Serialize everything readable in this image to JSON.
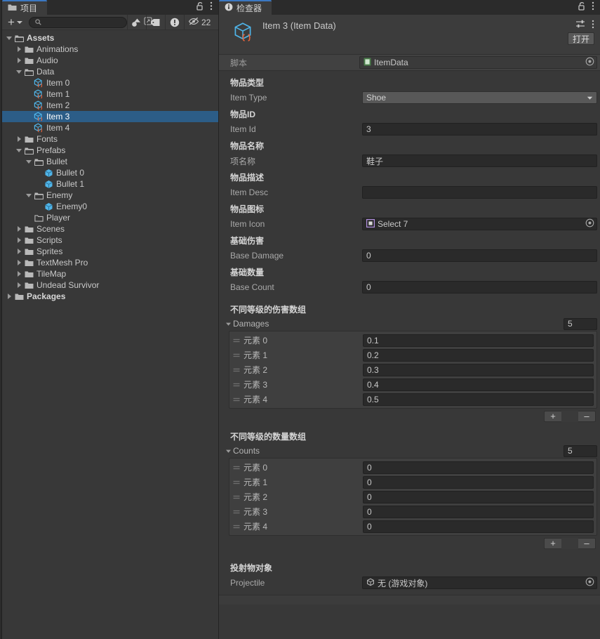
{
  "project_panel": {
    "tab_label": "项目",
    "tab_icon": "folder-icon",
    "lock_icon": "lock-open-icon",
    "menu_icon": "kebab-menu-icon",
    "toolbar": {
      "add_label": "+",
      "search_placeholder": "",
      "search_value": "",
      "search_icon": "search-icon",
      "save_search_icon": "save-search-icon",
      "filter_type_icon": "filter-by-type-icon",
      "filter_label_icon": "filter-by-label-icon",
      "filter_error_icon": "filter-by-error-icon",
      "hidden_icon": "eye-crossed-icon",
      "hidden_count": "22"
    },
    "tree": [
      {
        "label": "Assets",
        "indent": 0,
        "expand": "open",
        "icon": "folder-open-icon",
        "bold": true,
        "selected": false
      },
      {
        "label": "Animations",
        "indent": 1,
        "expand": "closed",
        "icon": "folder-icon",
        "bold": false,
        "selected": false
      },
      {
        "label": "Audio",
        "indent": 1,
        "expand": "closed",
        "icon": "folder-icon",
        "bold": false,
        "selected": false
      },
      {
        "label": "Data",
        "indent": 1,
        "expand": "open",
        "icon": "folder-open-icon",
        "bold": false,
        "selected": false
      },
      {
        "label": "Item 0",
        "indent": 2,
        "expand": "none",
        "icon": "scriptable-object-icon",
        "bold": false,
        "selected": false
      },
      {
        "label": "Item 1",
        "indent": 2,
        "expand": "none",
        "icon": "scriptable-object-icon",
        "bold": false,
        "selected": false
      },
      {
        "label": "Item 2",
        "indent": 2,
        "expand": "none",
        "icon": "scriptable-object-icon",
        "bold": false,
        "selected": false
      },
      {
        "label": "Item 3",
        "indent": 2,
        "expand": "none",
        "icon": "scriptable-object-icon",
        "bold": false,
        "selected": true
      },
      {
        "label": "Item 4",
        "indent": 2,
        "expand": "none",
        "icon": "scriptable-object-icon",
        "bold": false,
        "selected": false
      },
      {
        "label": "Fonts",
        "indent": 1,
        "expand": "closed",
        "icon": "folder-icon",
        "bold": false,
        "selected": false
      },
      {
        "label": "Prefabs",
        "indent": 1,
        "expand": "open",
        "icon": "folder-open-icon",
        "bold": false,
        "selected": false
      },
      {
        "label": "Bullet",
        "indent": 2,
        "expand": "open",
        "icon": "folder-open-icon",
        "bold": false,
        "selected": false
      },
      {
        "label": "Bullet 0",
        "indent": 3,
        "expand": "none",
        "icon": "prefab-icon",
        "bold": false,
        "selected": false
      },
      {
        "label": "Bullet 1",
        "indent": 3,
        "expand": "none",
        "icon": "prefab-icon",
        "bold": false,
        "selected": false
      },
      {
        "label": "Enemy",
        "indent": 2,
        "expand": "open",
        "icon": "folder-open-icon",
        "bold": false,
        "selected": false
      },
      {
        "label": "Enemy0",
        "indent": 3,
        "expand": "none",
        "icon": "prefab-icon",
        "bold": false,
        "selected": false
      },
      {
        "label": "Player",
        "indent": 2,
        "expand": "none",
        "icon": "folder-empty-icon",
        "bold": false,
        "selected": false
      },
      {
        "label": "Scenes",
        "indent": 1,
        "expand": "closed",
        "icon": "folder-icon",
        "bold": false,
        "selected": false
      },
      {
        "label": "Scripts",
        "indent": 1,
        "expand": "closed",
        "icon": "folder-icon",
        "bold": false,
        "selected": false
      },
      {
        "label": "Sprites",
        "indent": 1,
        "expand": "closed",
        "icon": "folder-icon",
        "bold": false,
        "selected": false
      },
      {
        "label": "TextMesh Pro",
        "indent": 1,
        "expand": "closed",
        "icon": "folder-icon",
        "bold": false,
        "selected": false
      },
      {
        "label": "TileMap",
        "indent": 1,
        "expand": "closed",
        "icon": "folder-icon",
        "bold": false,
        "selected": false
      },
      {
        "label": "Undead Survivor",
        "indent": 1,
        "expand": "closed",
        "icon": "folder-icon",
        "bold": false,
        "selected": false
      },
      {
        "label": "Packages",
        "indent": 0,
        "expand": "closed",
        "icon": "folder-icon",
        "bold": true,
        "selected": false
      }
    ]
  },
  "inspector": {
    "tab_label": "检查器",
    "tab_icon": "info-icon",
    "lock_icon": "lock-open-icon",
    "menu_icon": "kebab-menu-icon",
    "asset_title": "Item 3 (Item Data)",
    "asset_icon": "scriptable-object-icon",
    "preset_icon": "preset-settings-icon",
    "header_menu_icon": "kebab-menu-icon",
    "open_button": "打开",
    "script_row": {
      "label": "脚本",
      "value": "ItemData",
      "icon": "cs-script-icon",
      "picker_icon": "object-picker-icon"
    },
    "fields": [
      {
        "kind": "popup",
        "tip": "物品类型",
        "label": "Item Type",
        "value": "Shoe"
      },
      {
        "kind": "text",
        "tip": "物品ID",
        "label": "Item Id",
        "value": "3"
      },
      {
        "kind": "text",
        "tip": "物品名称",
        "label": "项名称",
        "value": "鞋子"
      },
      {
        "kind": "text",
        "tip": "物品描述",
        "label": "Item Desc",
        "value": ""
      },
      {
        "kind": "object",
        "tip": "物品图标",
        "label": "Item Icon",
        "value": "Select 7",
        "icon": "sprite-icon"
      },
      {
        "kind": "text",
        "tip": "基础伤害",
        "label": "Base Damage",
        "value": "0"
      },
      {
        "kind": "text",
        "tip": "基础数量",
        "label": "Base Count",
        "value": "0"
      }
    ],
    "arrays": [
      {
        "tip": "不同等级的伤害数组",
        "name": "Damages",
        "size": "5",
        "fold_icon": "triangle-down-icon",
        "elements": [
          {
            "label": "元素 0",
            "value": "0.1"
          },
          {
            "label": "元素 1",
            "value": "0.2"
          },
          {
            "label": "元素 2",
            "value": "0.3"
          },
          {
            "label": "元素 3",
            "value": "0.4"
          },
          {
            "label": "元素 4",
            "value": "0.5"
          }
        ],
        "add_label": "+",
        "remove_label": "–"
      },
      {
        "tip": "不同等级的数量数组",
        "name": "Counts",
        "size": "5",
        "fold_icon": "triangle-down-icon",
        "elements": [
          {
            "label": "元素 0",
            "value": "0"
          },
          {
            "label": "元素 1",
            "value": "0"
          },
          {
            "label": "元素 2",
            "value": "0"
          },
          {
            "label": "元素 3",
            "value": "0"
          },
          {
            "label": "元素 4",
            "value": "0"
          }
        ],
        "add_label": "+",
        "remove_label": "–"
      }
    ],
    "projectile": {
      "tip": "投射物对象",
      "label": "Projectile",
      "value": "无 (游戏对象)",
      "icon": "gameobject-icon",
      "picker_icon": "object-picker-icon"
    }
  },
  "colors": {
    "window_bg": "#383838",
    "panel_bg": "#3c3c3c",
    "selection_blue": "#2c5d87",
    "tab_accent": "#3b78c2",
    "field_bg": "#2a2a2a",
    "text": "#c9c9c9"
  }
}
